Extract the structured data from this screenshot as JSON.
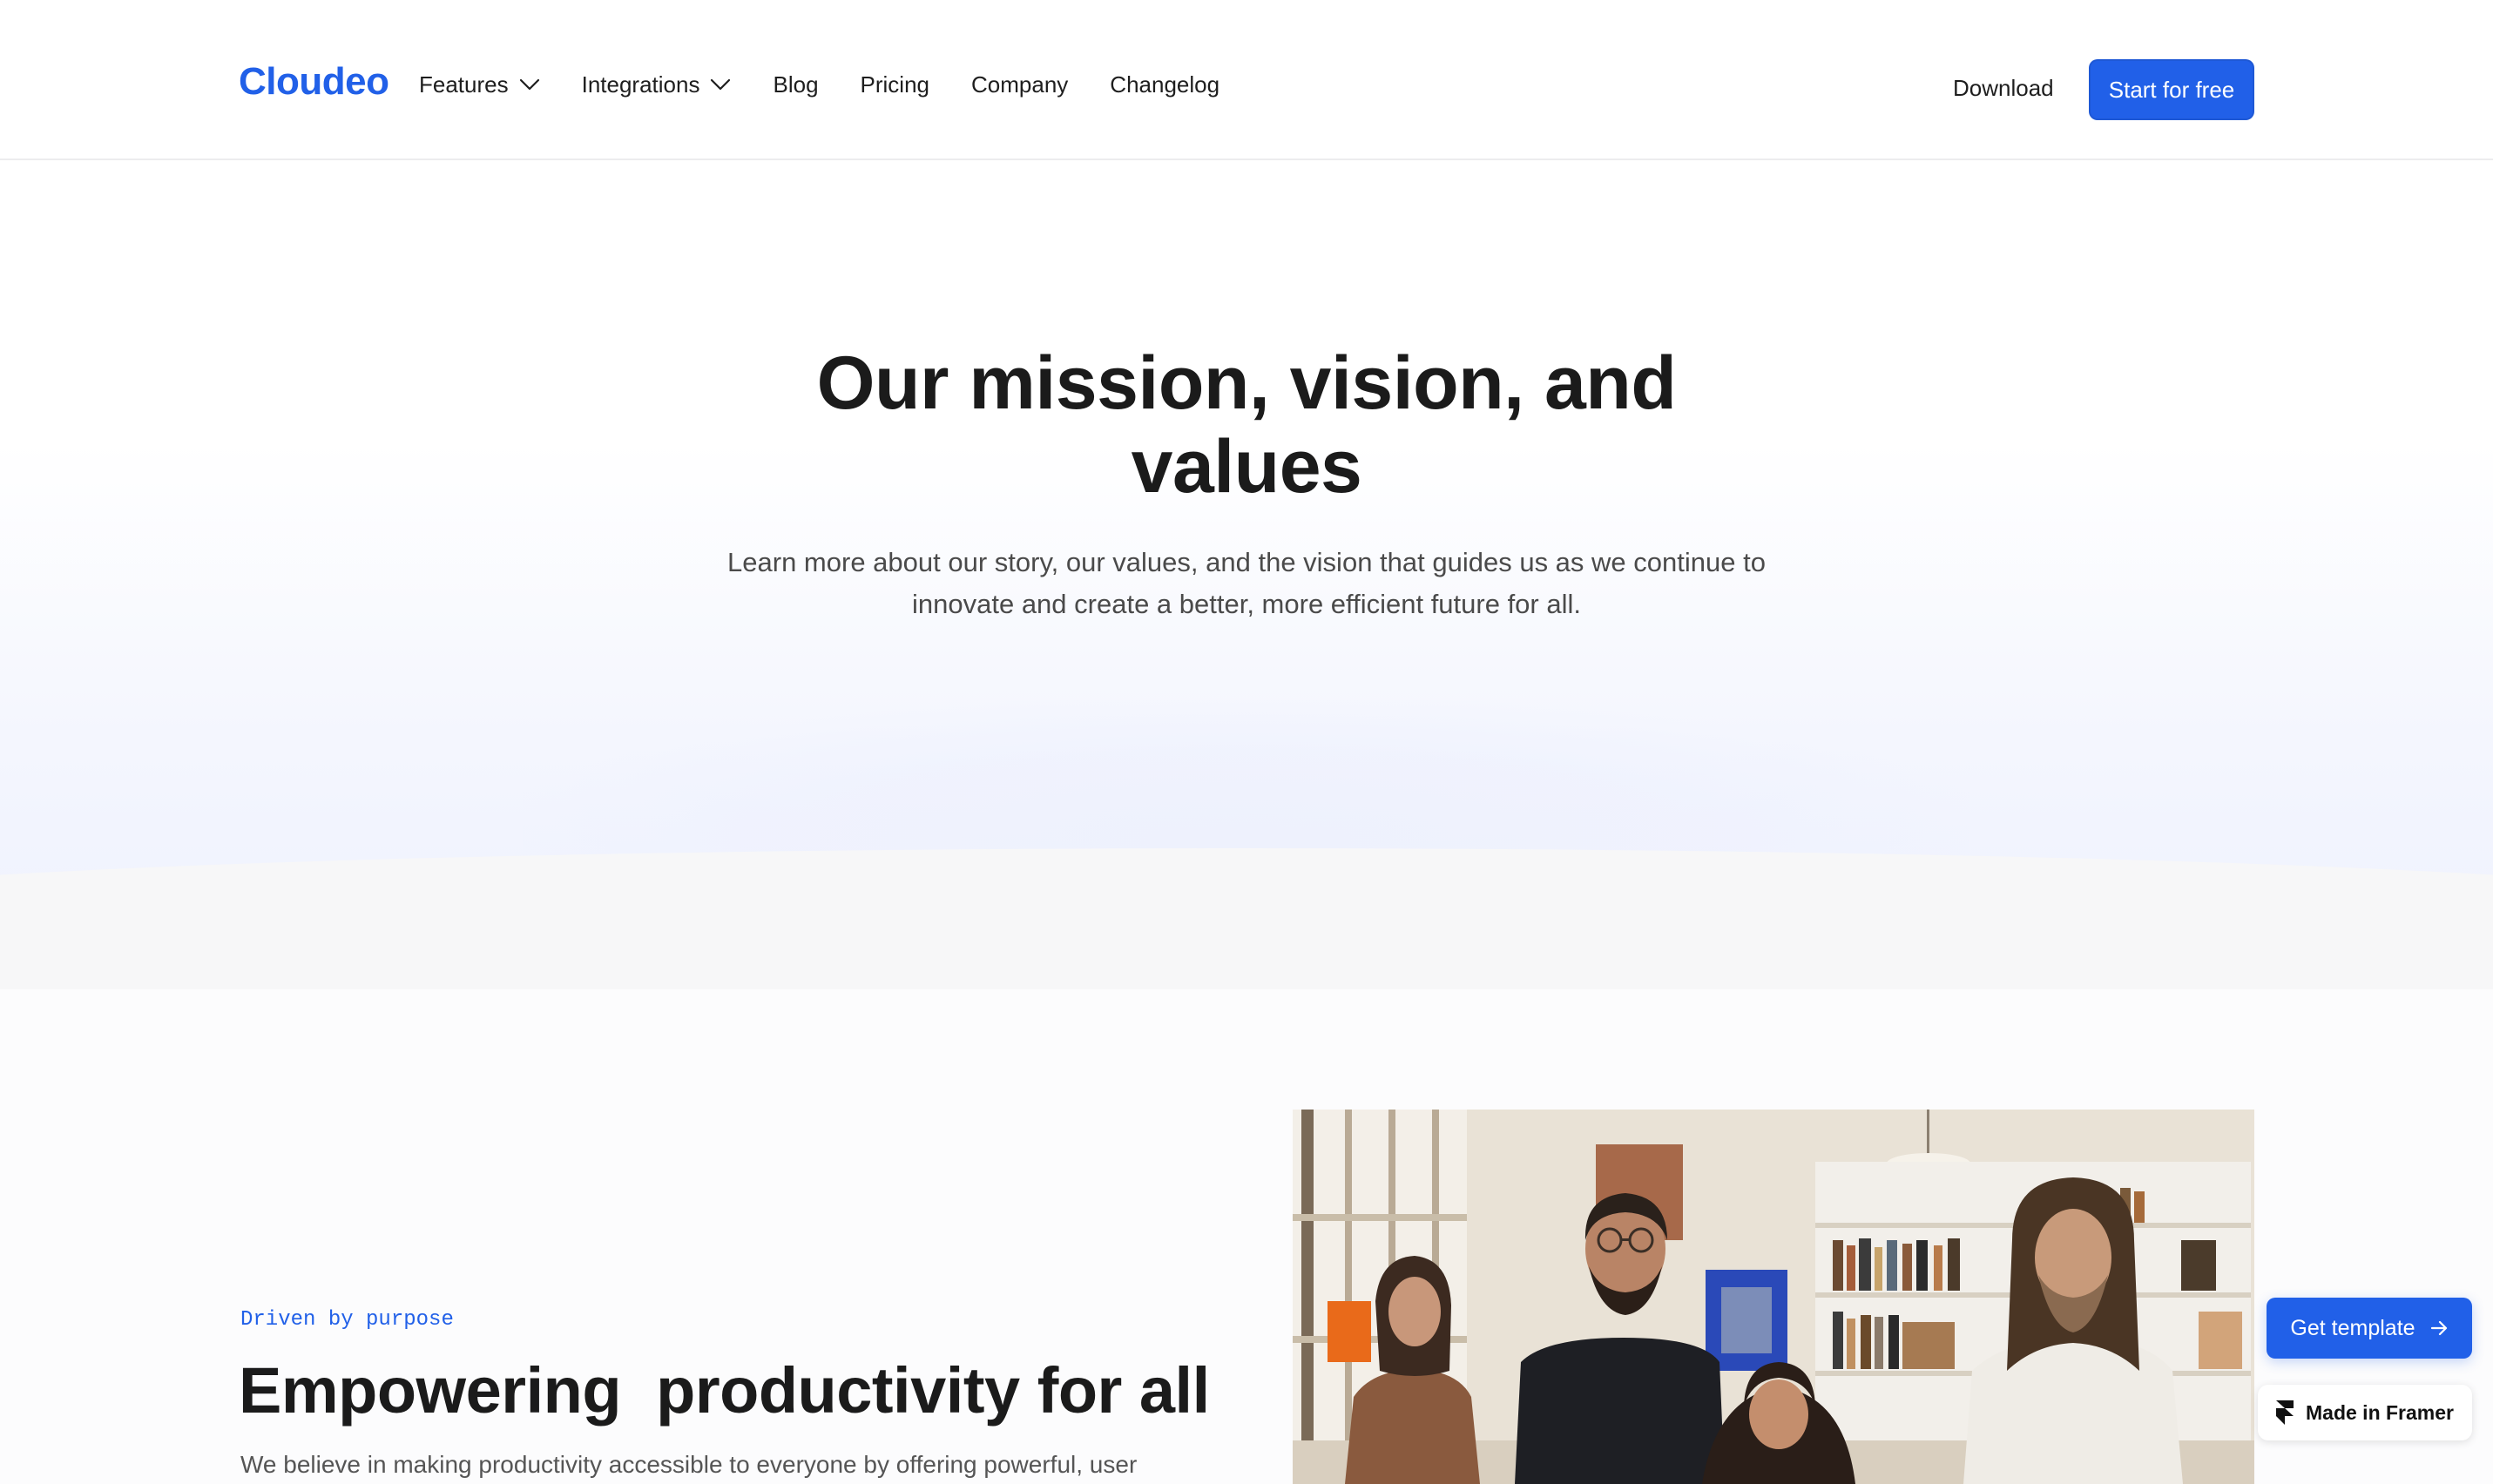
{
  "brand": {
    "logo_text": "Cloudeo",
    "accent_color": "#2160e8"
  },
  "nav": {
    "items": [
      {
        "label": "Features",
        "has_dropdown": true
      },
      {
        "label": "Integrations",
        "has_dropdown": true
      },
      {
        "label": "Blog",
        "has_dropdown": false
      },
      {
        "label": "Pricing",
        "has_dropdown": false
      },
      {
        "label": "Company",
        "has_dropdown": false
      },
      {
        "label": "Changelog",
        "has_dropdown": false
      }
    ],
    "download_label": "Download",
    "cta_label": "Start for free"
  },
  "hero": {
    "title": "Our mission, vision, and values",
    "subtitle": "Learn more about our story, our values, and the vision that guides us as we continue to innovate and create a better, more efficient future for all."
  },
  "section": {
    "eyebrow": "Driven by purpose",
    "title": "Empowering  productivity for all",
    "body_partial": "We believe in making productivity accessible to everyone by offering powerful, user",
    "image_icon": "team-photo"
  },
  "floating": {
    "get_template_label": "Get template",
    "get_template_icon": "arrow-right-icon",
    "made_in_framer_label": "Made in Framer",
    "made_in_framer_icon": "framer-logo-icon"
  }
}
